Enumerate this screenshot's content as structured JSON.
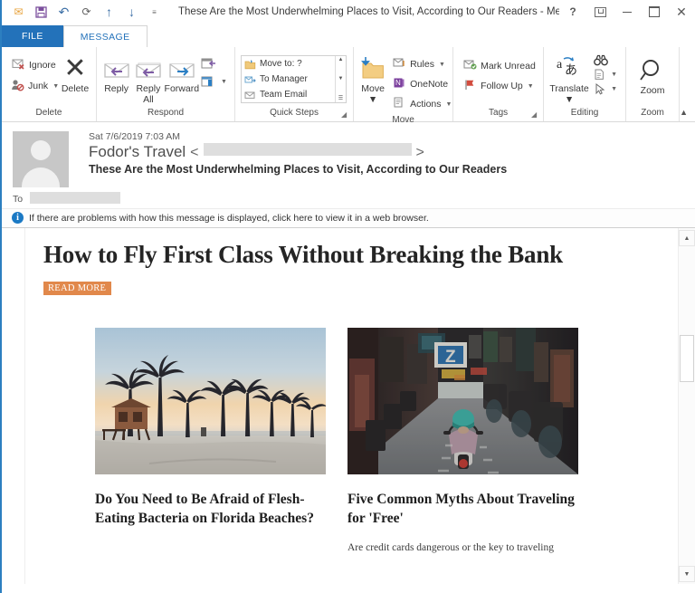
{
  "window": {
    "title": "These Are the Most Underwhelming Places to Visit, According to Our Readers - Message (HT...",
    "accent_color": "#2372ba"
  },
  "quick_access_toolbar": {
    "items": [
      {
        "name": "envelope-icon",
        "glyph": "✉"
      },
      {
        "name": "save-icon",
        "glyph": "💾"
      },
      {
        "name": "undo-icon",
        "glyph": "↶"
      },
      {
        "name": "redo-icon",
        "glyph": "↻"
      },
      {
        "name": "previous-item-icon",
        "glyph": "↑"
      },
      {
        "name": "next-item-icon",
        "glyph": "↓"
      },
      {
        "name": "customize-qat-icon",
        "glyph": "≡"
      }
    ]
  },
  "window_controls": {
    "help": "?",
    "ribbon_display_options": "ribbon-options-icon",
    "minimize": "─",
    "maximize": "□",
    "close": "✕"
  },
  "tabs": [
    {
      "label": "FILE",
      "active": false
    },
    {
      "label": "MESSAGE",
      "active": true
    }
  ],
  "ribbon": {
    "groups": [
      {
        "label": "Delete",
        "has_launcher": false,
        "small_buttons": [
          {
            "label": "Ignore",
            "icon": "ignore-icon",
            "caret": false
          },
          {
            "label": "Junk",
            "icon": "junk-icon",
            "caret": true
          }
        ],
        "big_buttons": [
          {
            "label": "Delete",
            "icon": "delete-x-icon"
          }
        ]
      },
      {
        "label": "Respond",
        "has_launcher": false,
        "big_buttons": [
          {
            "label": "Reply",
            "icon": "reply-icon"
          },
          {
            "label": "Reply All",
            "icon": "reply-all-icon"
          },
          {
            "label": "Forward",
            "icon": "forward-icon"
          }
        ],
        "stacked_icons": [
          {
            "label": "meeting-icon",
            "caret": false
          },
          {
            "label": "more-respond-icon",
            "caret": true
          }
        ]
      },
      {
        "label": "Quick Steps",
        "has_launcher": true,
        "gallery": [
          {
            "label": "Move to: ?",
            "icon": "move-to-folder-icon"
          },
          {
            "label": "To Manager",
            "icon": "to-manager-icon"
          },
          {
            "label": "Team Email",
            "icon": "team-email-icon"
          }
        ]
      },
      {
        "label": "Move",
        "has_launcher": false,
        "big_buttons": [
          {
            "label": "Move",
            "icon": "move-folder-icon",
            "caret": true
          }
        ],
        "small_buttons": [
          {
            "label": "Rules",
            "icon": "rules-icon",
            "caret": true
          },
          {
            "label": "OneNote",
            "icon": "onenote-icon",
            "caret": false
          },
          {
            "label": "Actions",
            "icon": "actions-icon",
            "caret": true
          }
        ]
      },
      {
        "label": "Tags",
        "has_launcher": true,
        "small_buttons": [
          {
            "label": "Mark Unread",
            "icon": "mark-unread-icon",
            "caret": false
          },
          {
            "label": "Follow Up",
            "icon": "follow-up-flag-icon",
            "caret": true
          }
        ]
      },
      {
        "label": "Editing",
        "has_launcher": false,
        "big_buttons": [
          {
            "label": "Translate",
            "icon": "translate-icon",
            "caret": true
          }
        ],
        "small_buttons": [
          {
            "label": "",
            "icon": "find-binoculars-icon",
            "caret": false
          },
          {
            "label": "",
            "icon": "document-select-icon",
            "caret": true
          },
          {
            "label": "",
            "icon": "pointer-select-icon",
            "caret": true
          }
        ]
      },
      {
        "label": "Zoom",
        "has_launcher": false,
        "big_buttons": [
          {
            "label": "Zoom",
            "icon": "zoom-magnifier-icon"
          }
        ]
      }
    ],
    "collapse_label": "collapse-ribbon-icon"
  },
  "message_header": {
    "date": "Sat 7/6/2019 7:03 AM",
    "sender_name": "Fodor's Travel",
    "sender_email_redacted": true,
    "angle_open": "<",
    "angle_close": ">",
    "subject": "These Are the Most Underwhelming Places to Visit, According to Our Readers",
    "to_label": "To",
    "to_value_redacted": true,
    "info_bar": "If there are problems with how this message is displayed, click here to view it in a web browser.",
    "avatar": "default-contact-avatar"
  },
  "newsletter": {
    "hero_headline": "How to Fly First Class Without Breaking the Bank",
    "read_more_label": "READ MORE",
    "read_more_color": "#e1884b",
    "cards": [
      {
        "image_name": "beach-palm-trees-sunset-photo",
        "title": "Do You Need to Be Afraid of Flesh-Eating Bacteria on Florida Beaches?",
        "body": ""
      },
      {
        "image_name": "narrow-alley-scooter-rider-photo",
        "title": "Five Common Myths About Traveling for 'Free'",
        "body": "Are credit cards dangerous or the key to traveling"
      }
    ]
  },
  "scrollbar": {
    "up_arrow": "▲",
    "down_arrow": "▼"
  }
}
